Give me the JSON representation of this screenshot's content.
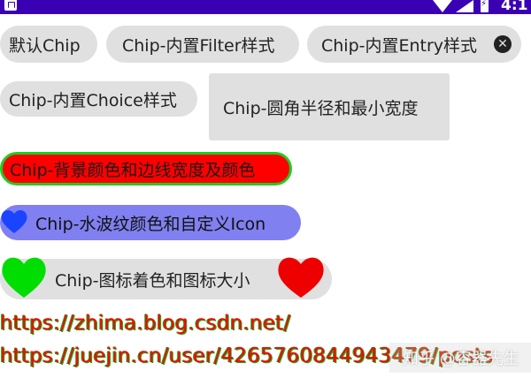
{
  "status_bar": {
    "time": "4:1",
    "icons": [
      "app-notification-icon",
      "wifi-icon",
      "signal-icon",
      "battery-charging-icon"
    ],
    "background": "#3a00b4"
  },
  "chips": {
    "default": {
      "label": "默认Chip"
    },
    "filter": {
      "label": "Chip-内置Filter样式"
    },
    "entry": {
      "label": "Chip-内置Entry样式",
      "close_icon": "close-icon"
    },
    "choice": {
      "label": "Chip-内置Choice样式"
    },
    "corner_radius": {
      "label": "Chip-圆角半径和最小宽度"
    },
    "background_stroke": {
      "label": "Chip-背景颜色和边线宽度及颜色",
      "background": "#ff0000",
      "stroke": "#22cc22"
    },
    "ripple_icon": {
      "label": "Chip-水波纹颜色和自定义Icon",
      "background": "#8080f0",
      "icon": "heart-icon",
      "icon_color": "#1a44ff"
    },
    "icon_tint": {
      "label": "Chip-图标着色和图标大小",
      "chip_icon": "heart-icon",
      "chip_icon_color": "#00dd00",
      "close_icon": "heart-icon",
      "close_icon_color": "#ee0000"
    }
  },
  "links": [
    "https://zhima.blog.csdn.net/",
    "https://juejin.cn/user/4265760844943479/posts"
  ],
  "watermark": "知乎 @容器先生",
  "colors": {
    "chip_gray": "#e0e0e0",
    "link_red": "#ff0000",
    "link_green": "#22aa22"
  }
}
